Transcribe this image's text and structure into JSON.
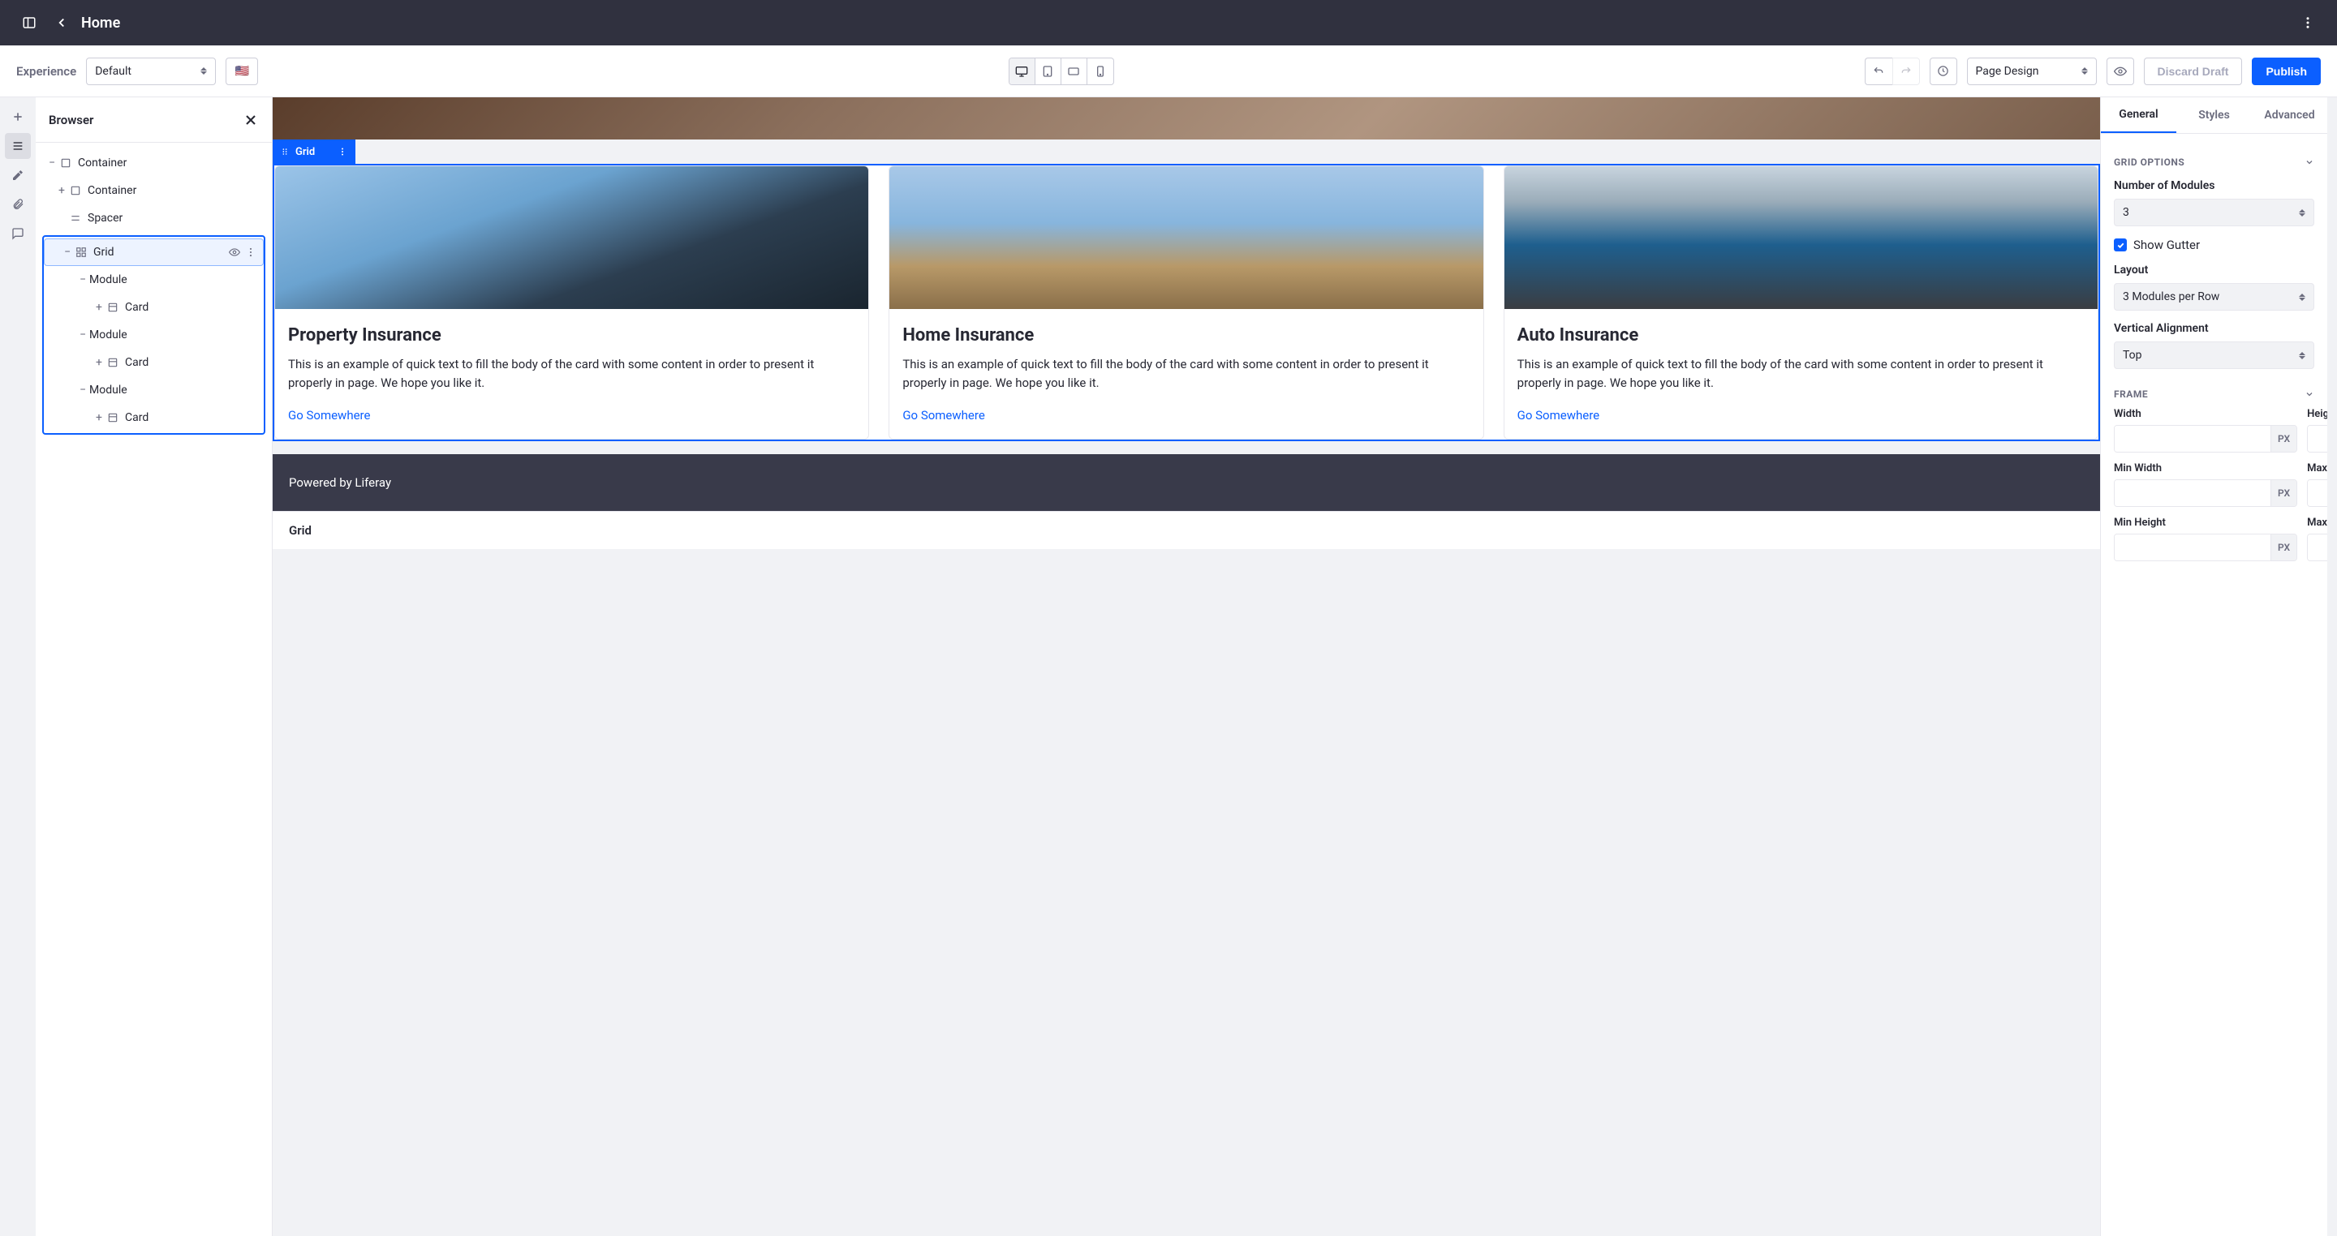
{
  "topbar": {
    "title": "Home"
  },
  "toolbar": {
    "experience_label": "Experience",
    "experience_value": "Default",
    "page_design_label": "Page Design",
    "discard_draft": "Discard Draft",
    "publish": "Publish",
    "flag": "🇺🇸"
  },
  "browser": {
    "title": "Browser",
    "tree": {
      "container": "Container",
      "container2": "Container",
      "spacer": "Spacer",
      "grid": "Grid",
      "module": "Module",
      "card": "Card"
    }
  },
  "canvas": {
    "grid_tag": "Grid",
    "cards": [
      {
        "title": "Property Insurance",
        "text": "This is an example of quick text to fill the body of the card with some content in order to present it properly in page. We hope you like it.",
        "link": "Go Somewhere"
      },
      {
        "title": "Home Insurance",
        "text": "This is an example of quick text to fill the body of the card with some content in order to present it properly in page. We hope you like it.",
        "link": "Go Somewhere"
      },
      {
        "title": "Auto Insurance",
        "text": "This is an example of quick text to fill the body of the card with some content in order to present it properly in page. We hope you like it.",
        "link": "Go Somewhere"
      }
    ],
    "footer": "Powered by Liferay",
    "breadcrumb": "Grid"
  },
  "right": {
    "tabs": {
      "general": "General",
      "styles": "Styles",
      "advanced": "Advanced"
    },
    "grid_options": {
      "header": "GRID OPTIONS",
      "num_modules_label": "Number of Modules",
      "num_modules_value": "3",
      "show_gutter": "Show Gutter",
      "layout_label": "Layout",
      "layout_value": "3 Modules per Row",
      "valign_label": "Vertical Alignment",
      "valign_value": "Top"
    },
    "frame": {
      "header": "FRAME",
      "width": "Width",
      "height": "Height",
      "min_width": "Min Width",
      "max_width": "Max Width",
      "min_height": "Min Height",
      "max_height": "Max Height",
      "unit": "PX"
    }
  }
}
